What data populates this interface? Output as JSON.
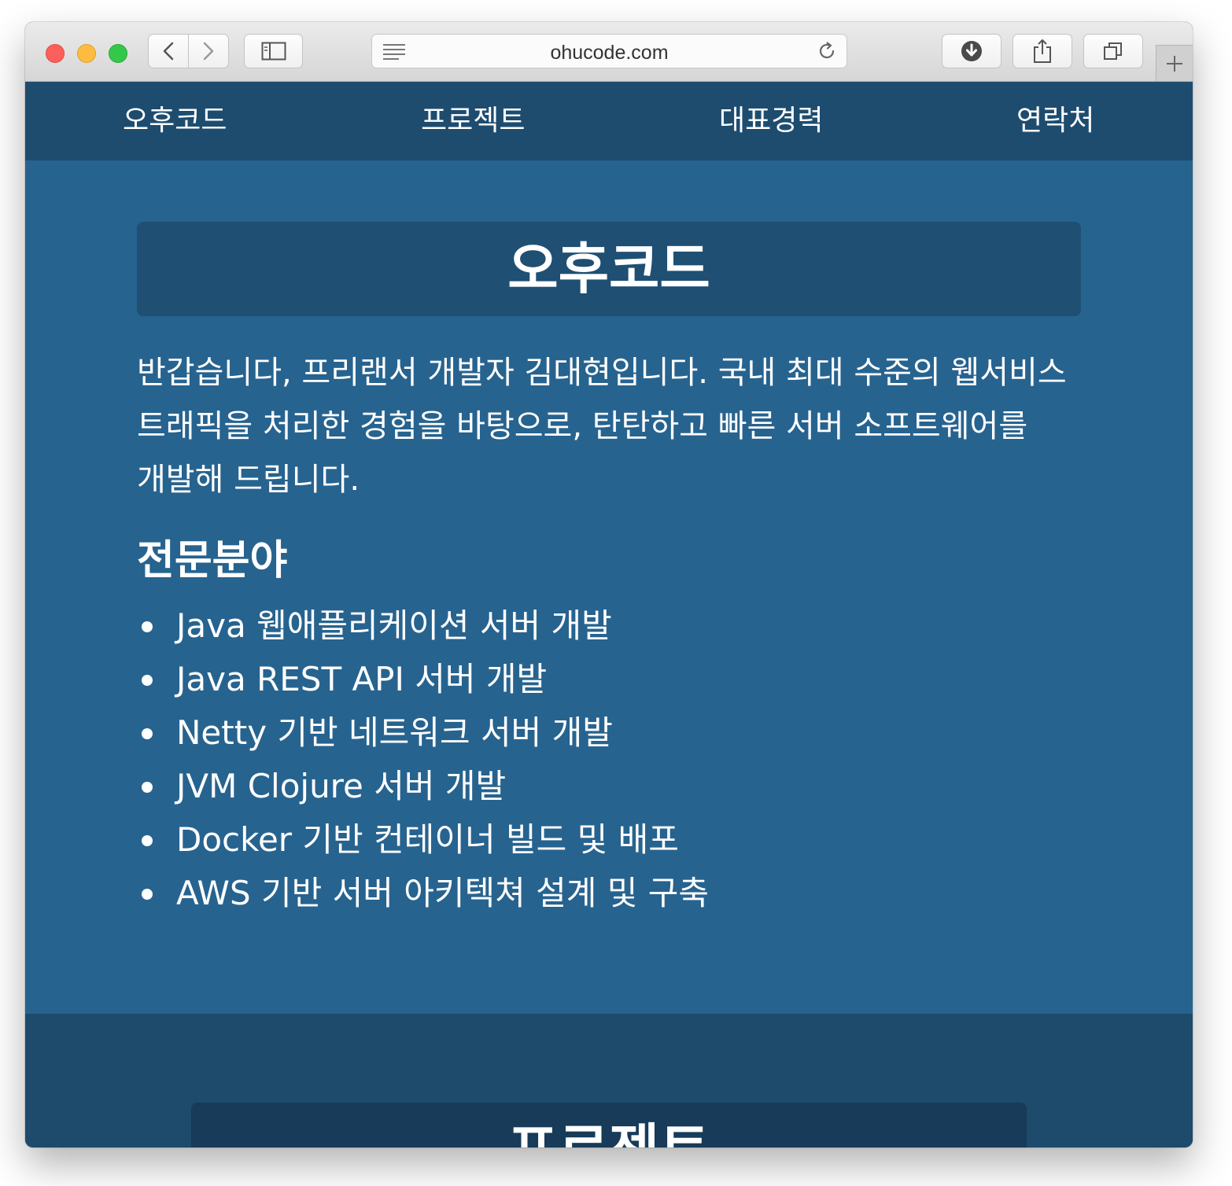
{
  "browser": {
    "url": "ohucode.com"
  },
  "nav": {
    "items": [
      "오후코드",
      "프로젝트",
      "대표경력",
      "연락처"
    ]
  },
  "intro": {
    "title": "오후코드",
    "description": "반갑습니다, 프리랜서 개발자 김대현입니다. 국내 최대 수준의 웹서비스 트래픽을 처리한 경험을 바탕으로, 탄탄하고 빠른 서버 소프트웨어를 개발해 드립니다.",
    "expertise_heading": "전문분야",
    "expertise": [
      "Java 웹애플리케이션 서버 개발",
      "Java REST API 서버 개발",
      "Netty 기반 네트워크 서버 개발",
      "JVM Clojure 서버 개발",
      "Docker 기반 컨테이너 빌드 및 배포",
      "AWS 기반 서버 아키텍쳐 설계 및 구축"
    ]
  },
  "projects": {
    "title": "프로젝트"
  },
  "colors": {
    "nav_bg": "#1e4c6f",
    "intro_bg": "#27638f",
    "title_box_bg": "#1f4f73",
    "projects_bg": "#1e4a6c",
    "projects_title_bg": "#173b59"
  },
  "icons": [
    "back-icon",
    "forward-icon",
    "sidebar-icon",
    "reader-icon",
    "reload-icon",
    "download-icon",
    "share-icon",
    "tabs-icon",
    "new-tab-icon"
  ]
}
